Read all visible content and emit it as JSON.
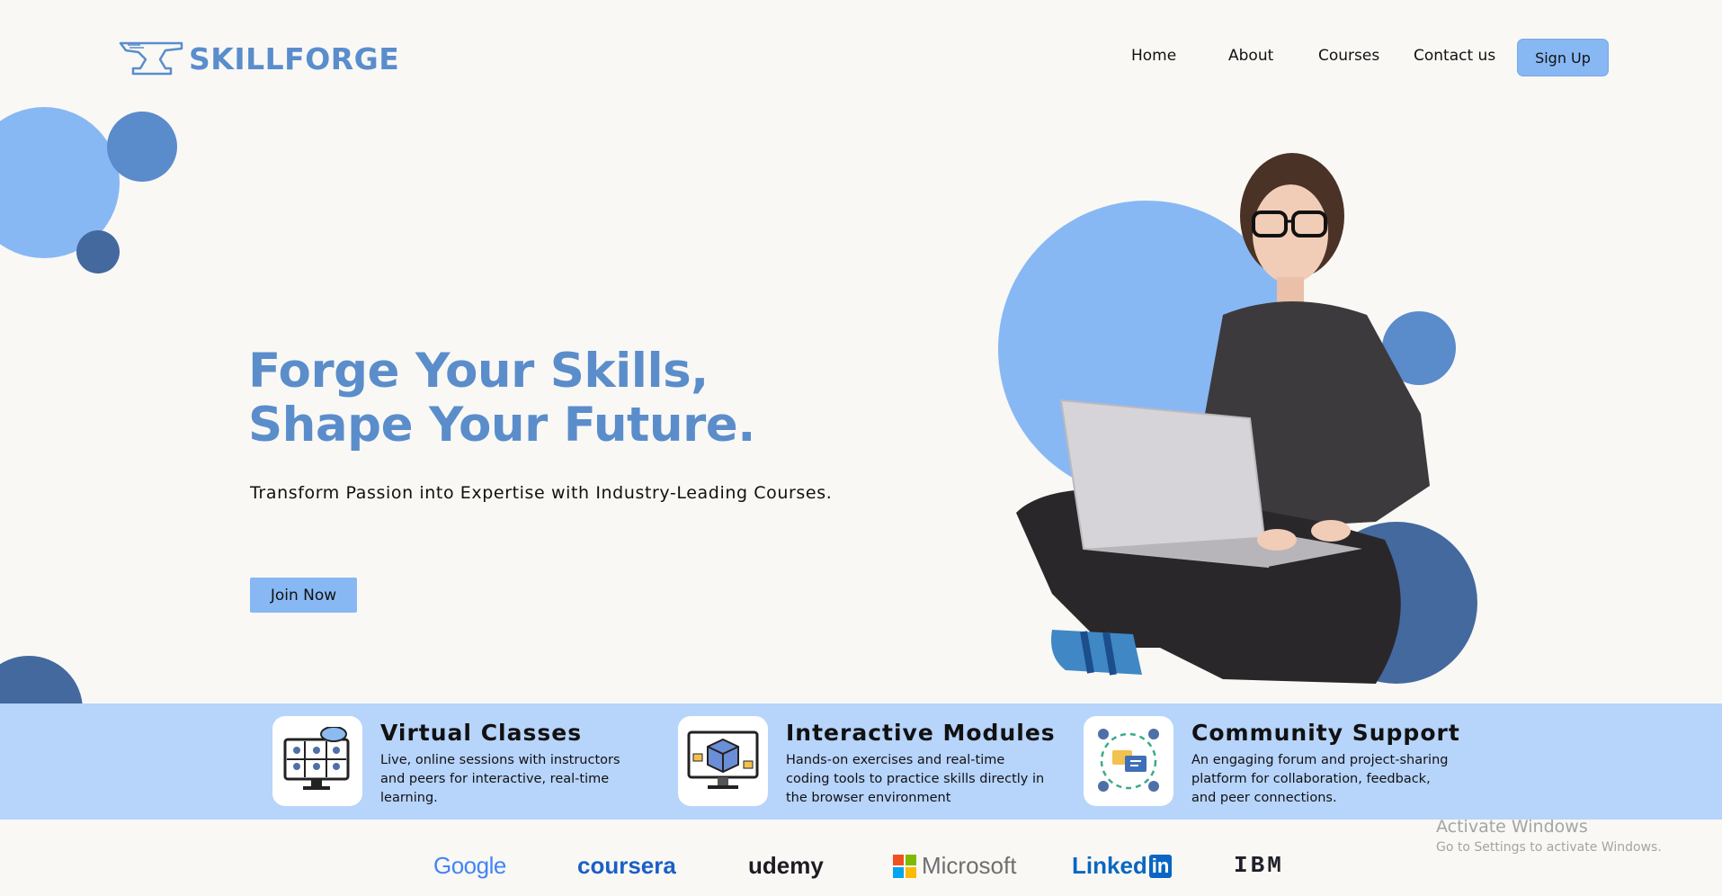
{
  "brand": {
    "name": "SKILLFORGE"
  },
  "nav": {
    "items": [
      "Home",
      "About",
      "Courses",
      "Contact us"
    ],
    "signup_label": "Sign Up"
  },
  "hero": {
    "title_line1": "Forge Your Skills,",
    "title_line2": "Shape Your Future.",
    "subtitle": "Transform Passion into Expertise with Industry-Leading Courses.",
    "cta_label": "Join Now"
  },
  "features": [
    {
      "title": "Virtual Classes",
      "description": "Live, online sessions with instructors and peers for interactive, real-time learning.",
      "icon": "video-conference-icon"
    },
    {
      "title": "Interactive Modules",
      "description": "Hands-on exercises and real-time coding tools to practice skills directly in the browser environment",
      "icon": "monitor-cube-icon"
    },
    {
      "title": "Community Support",
      "description": "An engaging forum and project-sharing platform for collaboration, feedback, and peer connections.",
      "icon": "community-chat-icon"
    }
  ],
  "partners": [
    "Google",
    "coursera",
    "udemy",
    "Microsoft",
    "Linked",
    "in",
    "IBM"
  ],
  "os_notice": {
    "title": "Activate Windows",
    "subtitle": "Go to Settings to activate Windows."
  },
  "colors": {
    "accent": "#88b8f4",
    "brand_blue": "#5b8dcb",
    "band": "#b7d4fb",
    "background": "#f9f8f5"
  }
}
